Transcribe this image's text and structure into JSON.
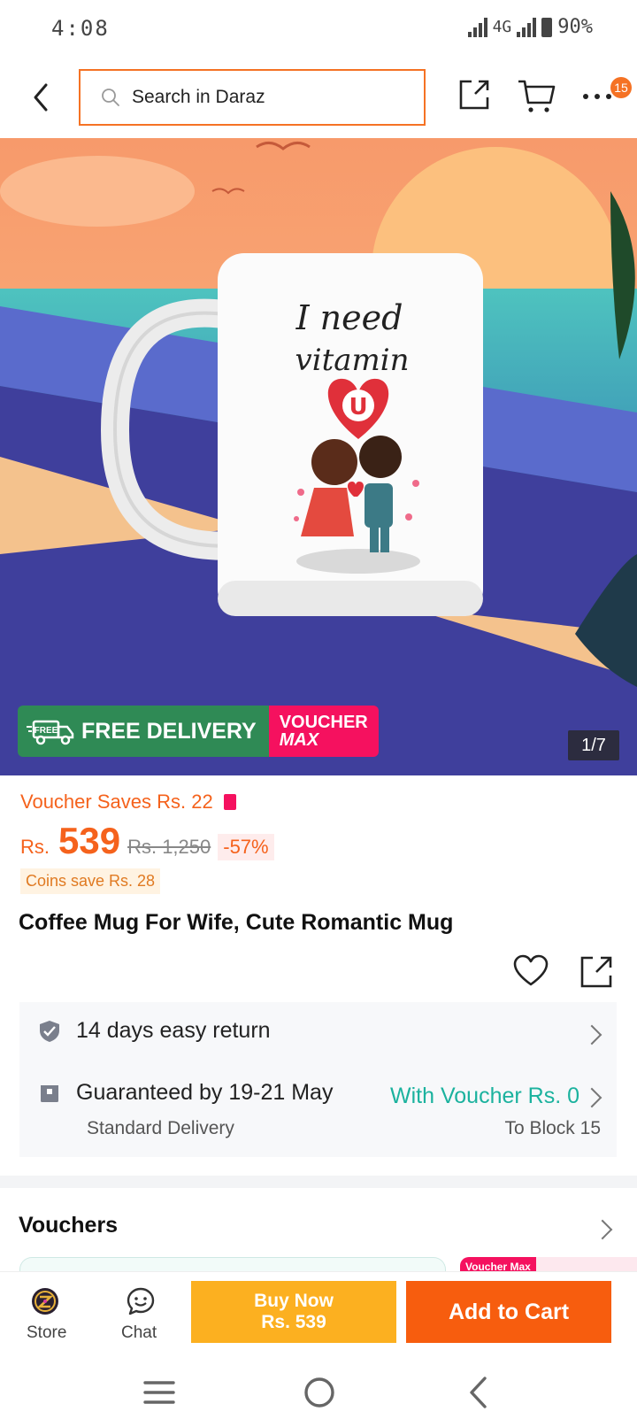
{
  "status_bar": {
    "time": "4:08",
    "network": "4G",
    "battery": "90%"
  },
  "header": {
    "search_placeholder": "Search in Daraz",
    "cart_badge": "15"
  },
  "hero": {
    "mug_text_line1": "I need",
    "mug_text_line2": "vitamin",
    "mug_heart_letter": "U",
    "free_tag": "FREE",
    "free_delivery_label": "FREE DELIVERY",
    "voucher_label_1": "VOUCHER",
    "voucher_label_2": "MAX",
    "image_counter": "1/7"
  },
  "product": {
    "voucher_saves": "Voucher Saves Rs. 22",
    "currency": "Rs.",
    "price": "539",
    "original_price": "Rs. 1,250",
    "discount": "-57%",
    "coins_save": "Coins save Rs. 28",
    "title": "Coffee Mug For Wife, Cute Romantic Mug"
  },
  "service": {
    "return_policy": "14 days easy return",
    "delivery_guarantee": "Guaranteed by 19-21 May",
    "delivery_voucher": "With Voucher Rs. 0",
    "delivery_type": "Standard Delivery",
    "delivery_to": "To Block 15"
  },
  "vouchers_section": {
    "title": "Vouchers",
    "peek_label": "Voucher Max"
  },
  "bottom_bar": {
    "store_label": "Store",
    "chat_label": "Chat",
    "buy_now_label": "Buy Now",
    "buy_now_price": "Rs. 539",
    "add_to_cart_label": "Add to Cart"
  },
  "colors": {
    "brand_orange": "#f57224",
    "buy_now": "#fcb020",
    "add_to_cart": "#f75d0e",
    "voucher_green": "#1bb29e"
  }
}
